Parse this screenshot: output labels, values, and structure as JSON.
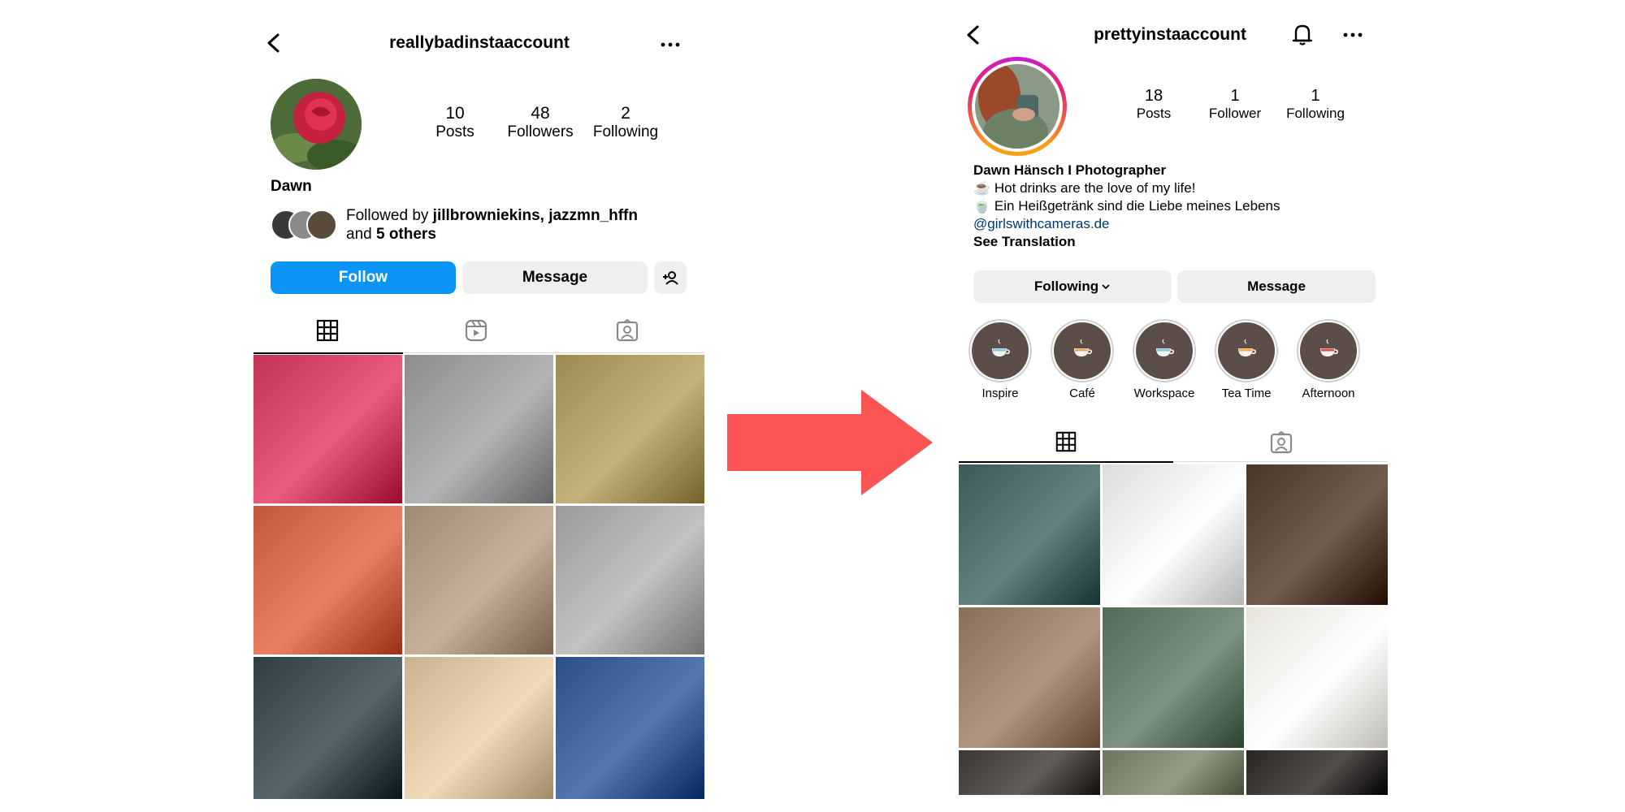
{
  "left_profile": {
    "username": "reallybadinstaaccount",
    "stats": [
      {
        "value": "10",
        "label": "Posts"
      },
      {
        "value": "48",
        "label": "Followers"
      },
      {
        "value": "2",
        "label": "Following"
      }
    ],
    "name": "Dawn",
    "followed_by_prefix": "Followed by ",
    "followed_by_names": "jillbrowniekins, jazzmn_hffn",
    "followed_by_and": "and ",
    "followed_by_others": "5 others",
    "buttons": {
      "follow": "Follow",
      "message": "Message"
    },
    "icons": [
      "back-arrow-icon",
      "more-options-icon",
      "add-person-icon",
      "grid-icon",
      "reels-icon",
      "tagged-icon"
    ],
    "grid_colors": [
      "#c23454",
      "#8c8c8c",
      "#9b8a52",
      "#c2573b",
      "#9e8a74",
      "#9a9a9a",
      "#2f3e44",
      "#c9b28f",
      "#2b4f86"
    ]
  },
  "right_profile": {
    "username": "prettyinstaaccount",
    "stats": [
      {
        "value": "18",
        "label": "Posts"
      },
      {
        "value": "1",
        "label": "Follower"
      },
      {
        "value": "1",
        "label": "Following"
      }
    ],
    "bio_name": "Dawn Hänsch I  Photographer",
    "bio_line1_emoji": "☕",
    "bio_line1": "Hot drinks are the love of my life!",
    "bio_line2_emoji": "🍵",
    "bio_line2": "Ein Heißgetränk sind die Liebe meines Lebens",
    "bio_link": "@girlswithcameras.de",
    "see_translation": "See Translation",
    "buttons": {
      "following": "Following",
      "message": "Message"
    },
    "highlights": [
      "Inspire",
      "Café",
      "Workspace",
      "Tea Time",
      "Afternoon"
    ],
    "icons": [
      "back-arrow-icon",
      "bell-icon",
      "more-options-icon",
      "chevron-down-icon",
      "grid-icon",
      "tagged-icon",
      "cup-icon"
    ],
    "grid_colors": [
      "#3d5a58",
      "#dcdcdc",
      "#4a3628",
      "#8b6e57",
      "#556b58",
      "#e6e3dc",
      "#3a3632",
      "#6b7560",
      "#2a2624"
    ],
    "colors": {
      "link": "#00376b",
      "ring_start": "#f9a01b",
      "ring_mid": "#e3266e",
      "ring_end": "#c51fd3"
    }
  },
  "arrow": {
    "color": "#fa5454"
  }
}
